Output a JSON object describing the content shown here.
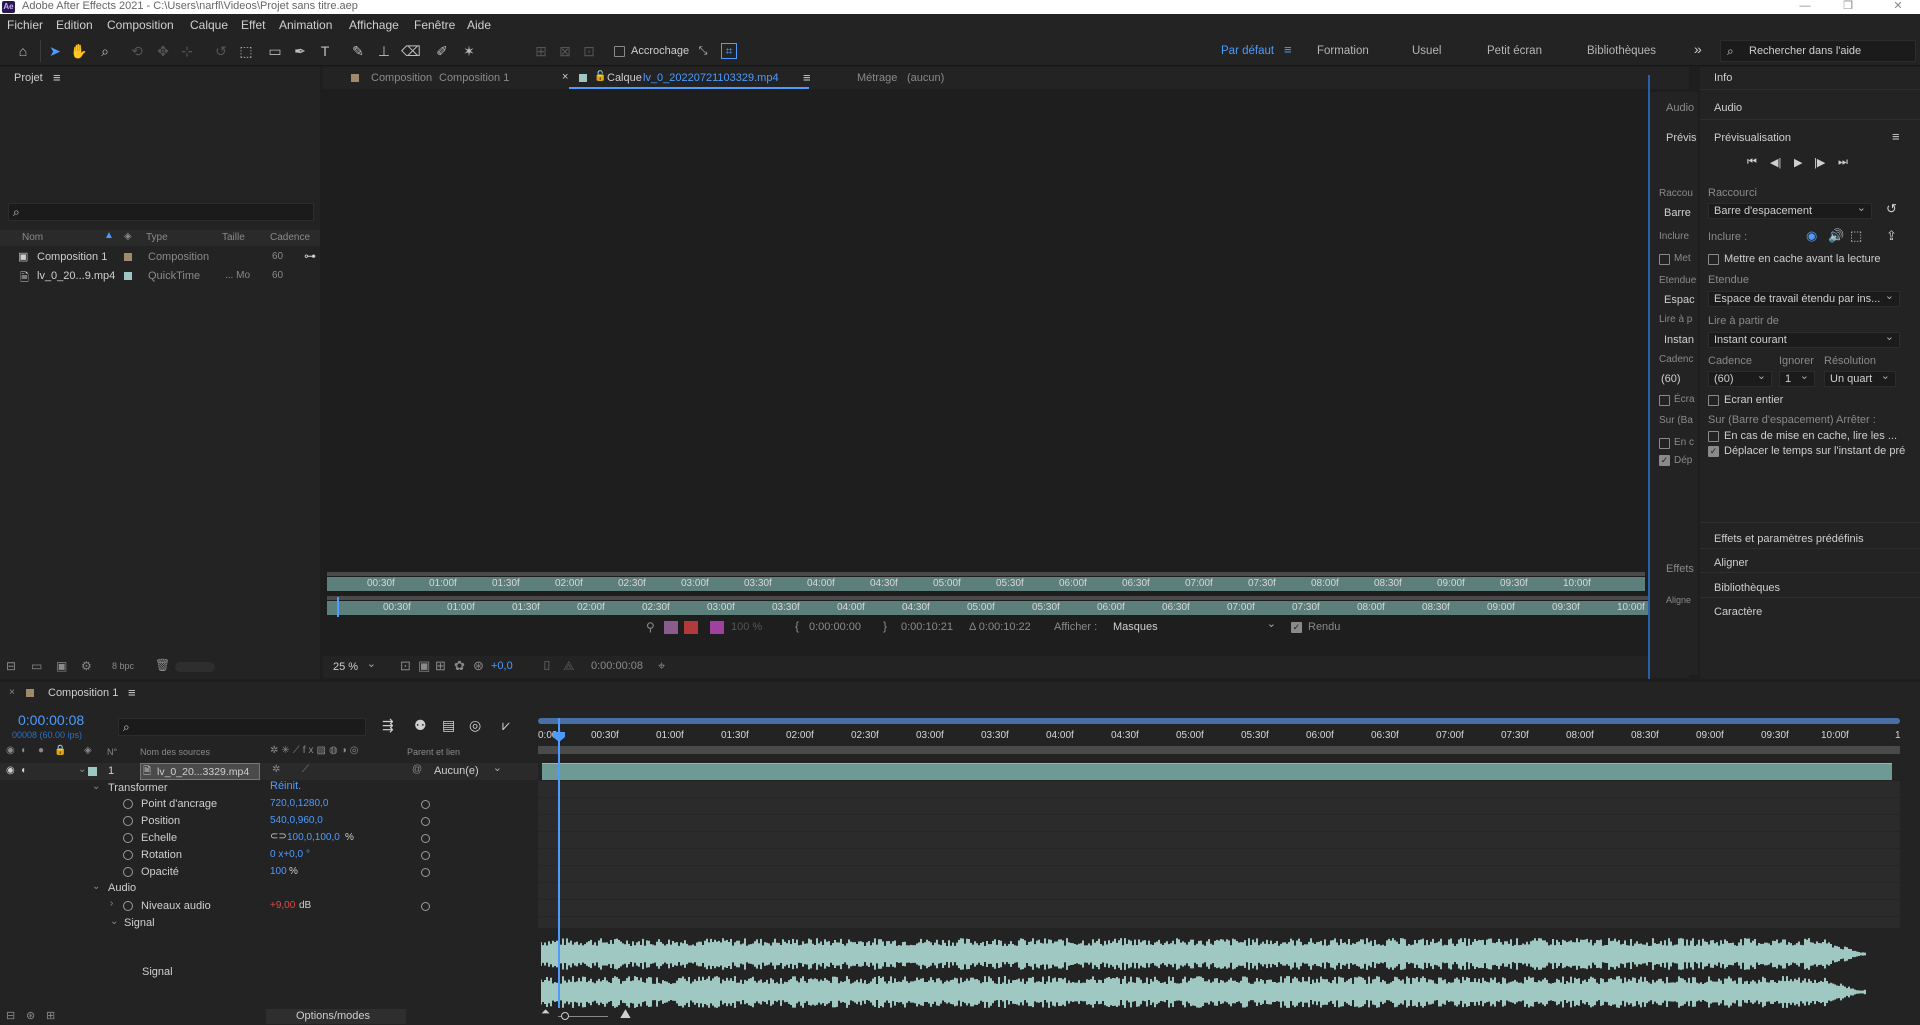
{
  "window": {
    "title": "Adobe After Effects 2021 - C:\\Users\\narfl\\Videos\\Projet sans titre.aep",
    "logo": "Ae"
  },
  "menu": [
    "Fichier",
    "Edition",
    "Composition",
    "Calque",
    "Effet",
    "Animation",
    "Affichage",
    "Fenêtre",
    "Aide"
  ],
  "toolbar": {
    "snapping_label": "Accrochage",
    "workspaces": [
      "Par défaut",
      "Formation",
      "Usuel",
      "Petit écran",
      "Bibliothèques"
    ],
    "active_workspace": "Par défaut",
    "search_placeholder": "Rechercher dans l'aide",
    "more": "»"
  },
  "project": {
    "title": "Projet",
    "columns": [
      "Nom",
      "Type",
      "Taille",
      "Cadence"
    ],
    "items": [
      {
        "name": "Composition 1",
        "type": "Composition",
        "size": "",
        "rate": "60"
      },
      {
        "name": "lv_0_20...9.mp4",
        "type": "QuickTime",
        "size": "... Mo",
        "rate": "60"
      }
    ],
    "bpc": "8 bpc"
  },
  "viewer": {
    "tabs": [
      {
        "label": "Composition",
        "name": "Composition 1"
      },
      {
        "label": "Calque",
        "name": "lv_0_20220721103329.mp4"
      },
      {
        "label": "Métrage",
        "name": "(aucun)"
      }
    ],
    "ruler_top": [
      "00:30f",
      "01:00f",
      "01:30f",
      "02:00f",
      "02:30f",
      "03:00f",
      "03:30f",
      "04:00f",
      "04:30f",
      "05:00f",
      "05:30f",
      "06:00f",
      "06:30f",
      "07:00f",
      "07:30f",
      "08:00f",
      "08:30f",
      "09:00f",
      "09:30f",
      "10:00f"
    ],
    "ruler_bottom": [
      "00:30f",
      "01:00f",
      "01:30f",
      "02:00f",
      "02:30f",
      "03:00f",
      "03:30f",
      "04:00f",
      "04:30f",
      "05:00f",
      "05:30f",
      "06:00f",
      "06:30f",
      "07:00f",
      "07:30f",
      "08:00f",
      "08:30f",
      "09:00f",
      "09:30f",
      "10:00f"
    ],
    "opacity": "100 %",
    "in_point": "0:00:00:00",
    "out_point": "0:00:10:21",
    "duration": "Δ 0:00:10:22",
    "show_label": "Afficher :",
    "show_value": "Masques",
    "render_label": "Rendu",
    "zoom": "25 %",
    "exposure": "+0,0",
    "timecode": "0:00:00:08"
  },
  "right_panel": {
    "collapsed_labels": [
      "Audio",
      "Prévis",
      "Raccou",
      "Barre",
      "Inclure",
      "Met",
      "Etendue",
      "Espac",
      "Lire à p",
      "Instan",
      "Cadenc",
      "(60)",
      "Écra",
      "Sur (Ba",
      "En c",
      "Dép",
      "Effets",
      "Aligne"
    ],
    "info": "Info",
    "audio": "Audio",
    "preview_title": "Prévisualisation",
    "shortcut_label": "Raccourci",
    "shortcut_value": "Barre d'espacement",
    "include_label": "Inclure :",
    "cache_label": "Mettre en cache avant la lecture",
    "range_label": "Etendue",
    "range_value": "Espace de travail étendu par ins...",
    "play_from_label": "Lire à partir de",
    "play_from_value": "Instant courant",
    "rate_label": "Cadence",
    "rate_value": "(60)",
    "skip_label": "Ignorer",
    "skip_value": "1",
    "res_label": "Résolution",
    "res_value": "Un quart",
    "fullscreen_label": "Ecran entier",
    "on_stop_label": "Sur (Barre d'espacement) Arrêter :",
    "if_cached_label": "En cas de mise en cache, lire les ...",
    "move_time_label": "Déplacer le temps sur l'instant de pré",
    "effects": "Effets et paramètres prédéfinis",
    "align": "Aligner",
    "libraries": "Bibliothèques",
    "character": "Caractère"
  },
  "timeline": {
    "tab": "Composition 1",
    "timecode": "0:00:00:08",
    "frames": "00008 (60.00 ips)",
    "columns": {
      "num": "N°",
      "source": "Nom des sources",
      "parent": "Parent et lien"
    },
    "layer": {
      "num": "1",
      "name": "lv_0_20...3329.mp4",
      "parent": "Aucun(e)"
    },
    "ruler": [
      "0:00f",
      "00:30f",
      "01:00f",
      "01:30f",
      "02:00f",
      "02:30f",
      "03:00f",
      "03:30f",
      "04:00f",
      "04:30f",
      "05:00f",
      "05:30f",
      "06:00f",
      "06:30f",
      "07:00f",
      "07:30f",
      "08:00f",
      "08:30f",
      "09:00f",
      "09:30f",
      "10:00f",
      "1"
    ],
    "transform": "Transformer",
    "reset": "Réinit.",
    "properties": [
      {
        "name": "Point d'ancrage",
        "value": "720,0,1280,0",
        "unit": ""
      },
      {
        "name": "Position",
        "value": "540,0,960,0",
        "unit": ""
      },
      {
        "name": "Echelle",
        "value": "100,0,100,0",
        "unit": "%"
      },
      {
        "name": "Rotation",
        "value": "0 x+0,0",
        "unit": "°"
      },
      {
        "name": "Opacité",
        "value": "100",
        "unit": "%"
      }
    ],
    "audio": "Audio",
    "audio_levels": {
      "name": "Niveaux audio",
      "value": "+9,00",
      "unit": "dB"
    },
    "signal": "Signal",
    "signal_sub": "Signal",
    "footer": "Options/modes"
  },
  "colors": {
    "accent": "#4d9bff",
    "track": "#5c8c88",
    "wave": "#9fc8c3",
    "red": "#e04848"
  }
}
